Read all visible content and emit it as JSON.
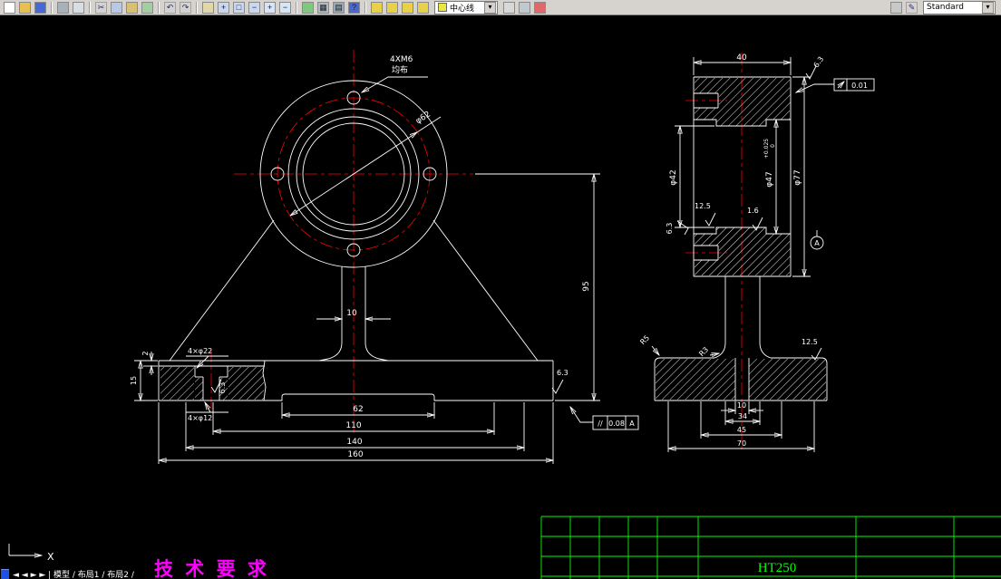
{
  "colors": {
    "background": "#000000",
    "line": "#ffffff",
    "centerline": "#ff0000",
    "title_block": "#00ff00",
    "notes": "#ff00ff",
    "toolbar_bg": "#d6d3ce"
  },
  "toolbar": {
    "layer_combo": "中心线",
    "style_combo": "Standard",
    "combo_arrow": "▾",
    "icons_left": [
      {
        "name": "new-file-icon",
        "color": "#ffffff"
      },
      {
        "name": "open-folder-icon",
        "color": "#e8c050"
      },
      {
        "name": "save-icon",
        "color": "#4868d8"
      },
      {
        "separator": true
      },
      {
        "name": "print-icon",
        "color": "#a8b0b8"
      },
      {
        "name": "print-preview-icon",
        "color": "#d8dde6"
      },
      {
        "separator": true
      },
      {
        "name": "cut-icon",
        "glyph": "✂"
      },
      {
        "name": "copy-icon",
        "color": "#b8c8e8"
      },
      {
        "name": "paste-icon",
        "color": "#d8c070"
      },
      {
        "name": "match-properties-icon",
        "color": "#a0d0a0"
      },
      {
        "separator": true
      },
      {
        "name": "undo-icon",
        "glyph": "↶"
      },
      {
        "name": "redo-icon",
        "glyph": "↷"
      },
      {
        "separator": true
      },
      {
        "name": "pan-hand-icon",
        "color": "#e0d8a8"
      },
      {
        "name": "zoom-realtime-icon",
        "color": "#c8d8f0",
        "glyph": "+"
      },
      {
        "name": "zoom-window-icon",
        "color": "#c8d8f0",
        "glyph": "□"
      },
      {
        "name": "zoom-previous-icon",
        "color": "#c8d8f0",
        "glyph": "−"
      },
      {
        "name": "zoom-in-icon",
        "color": "#d8e4f8",
        "glyph": "+"
      },
      {
        "name": "zoom-out-icon",
        "color": "#d8e4f8",
        "glyph": "−"
      },
      {
        "separator": true
      },
      {
        "name": "redraw-icon",
        "color": "#80c880"
      },
      {
        "name": "calculator-icon",
        "color": "#b0bac4",
        "glyph": "▦"
      },
      {
        "name": "table-icon",
        "color": "#98a8b8",
        "glyph": "▤"
      },
      {
        "name": "help-icon",
        "color": "#4868d8",
        "glyph": "?"
      },
      {
        "separator": true
      },
      {
        "name": "distance-icon",
        "color": "#e8d048"
      },
      {
        "name": "area-icon",
        "color": "#e8d048"
      },
      {
        "name": "list-icon",
        "color": "#e8d048"
      },
      {
        "name": "object-properties-icon",
        "color": "#e8d048"
      }
    ],
    "icons_mid": [
      {
        "name": "layer-manager-icon",
        "color": "#d8d8d8"
      },
      {
        "name": "linetype-icon",
        "color": "#c0c8d0"
      },
      {
        "name": "color-control-icon",
        "color": "#e06868"
      }
    ],
    "icons_right": [
      {
        "name": "osnap-icon",
        "color": "#c8c8c8"
      },
      {
        "name": "pencil-icon",
        "glyph": "✎"
      }
    ]
  },
  "front_view": {
    "thread_note": "4XM6",
    "thread_note2": "均布",
    "bolt_circle_dia": "φ62",
    "dim_height": "95",
    "dim_rib": "10",
    "dim_step": "2",
    "dim_base_h": "15",
    "cbore_note": "4×φ22",
    "hole_note": "4×φ12",
    "rough_cbore": "6.3",
    "rough_base": "6.3",
    "dim_recess": "62",
    "dim_holes": "110",
    "dim_140": "140",
    "dim_overall": "160",
    "fcf": {
      "symbol": "//",
      "tolerance": "0.08",
      "datum": "A"
    }
  },
  "side_view": {
    "dim_length": "40",
    "fcf": {
      "symbol_name": "circular-runout",
      "value": "0.01"
    },
    "dia_42": "φ42",
    "dia_47": "φ47",
    "dia_47_tol_up": "+0.025",
    "dia_47_tol_dn": "0",
    "dia_77": "φ77",
    "rough_left": "6.3",
    "rough_face": "6.3",
    "rough_bore": "12.5",
    "rough_mid": "1.6",
    "datum_label": "A",
    "r5": "R5",
    "r3": "R3",
    "rough_base_top": "12.5",
    "dim_10": "10",
    "dim_34": "34",
    "dim_45": "45",
    "dim_70": "70"
  },
  "title_block": {
    "material": "HT250"
  },
  "notes": {
    "tech_requirements": "技 术 要 求"
  },
  "status": {
    "layout_tabs": "◄ ◄ ► ► |  模型 / 布局1 / 布局2 /"
  },
  "ucs": {
    "axis_label": "X"
  }
}
